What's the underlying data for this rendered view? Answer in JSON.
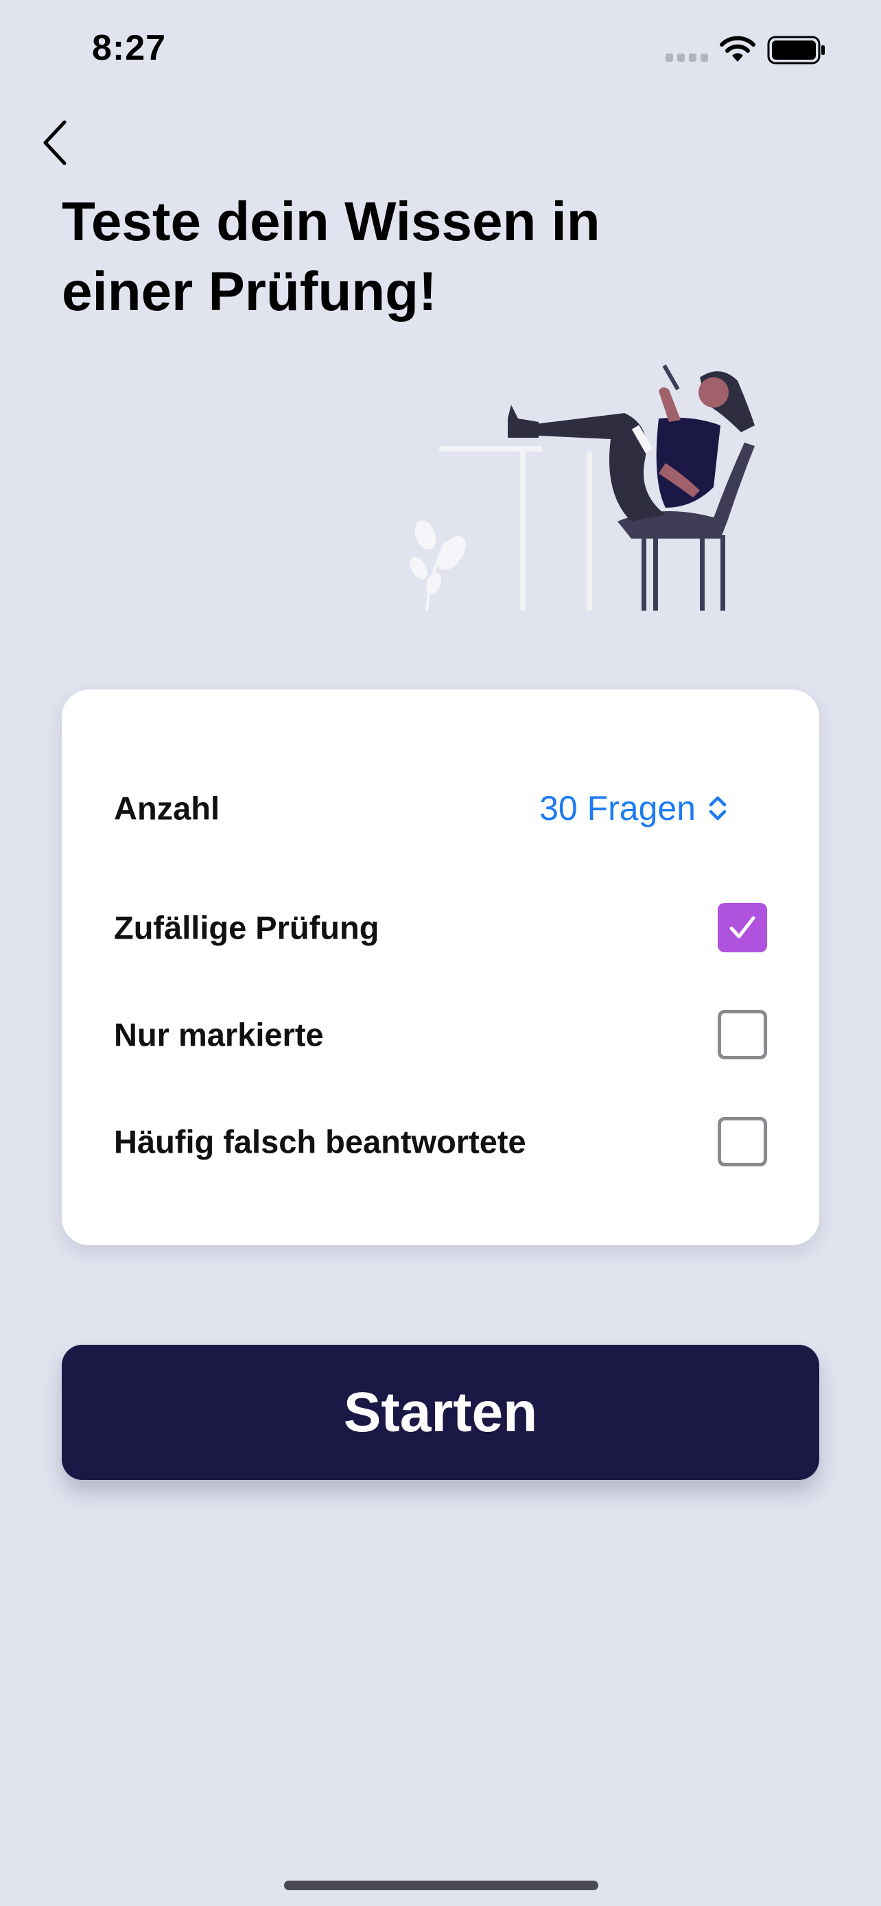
{
  "status_bar": {
    "time": "8:27",
    "signal_icon": "cellular-signal-icon",
    "wifi_icon": "wifi-icon",
    "battery_icon": "battery-icon"
  },
  "navigation": {
    "back_icon": "chevron-left-icon"
  },
  "header": {
    "title": "Teste dein Wissen in einer Prüfung!"
  },
  "illustration": {
    "icon": "woman-relaxing-on-chair-illustration"
  },
  "settings": {
    "count": {
      "label": "Anzahl",
      "value": "30 Fragen",
      "icon": "chevron-up-down-icon"
    },
    "options": [
      {
        "label": "Zufällige Prüfung",
        "checked": true
      },
      {
        "label": "Nur markierte",
        "checked": false
      },
      {
        "label": "Häufig falsch beantwortete",
        "checked": false
      }
    ]
  },
  "start_button": {
    "label": "Starten"
  },
  "colors": {
    "background": "#e1e4ef",
    "card": "#ffffff",
    "accent_blue": "#1e7cf2",
    "checkbox_checked": "#af52de",
    "button_dark": "#1b1846"
  }
}
